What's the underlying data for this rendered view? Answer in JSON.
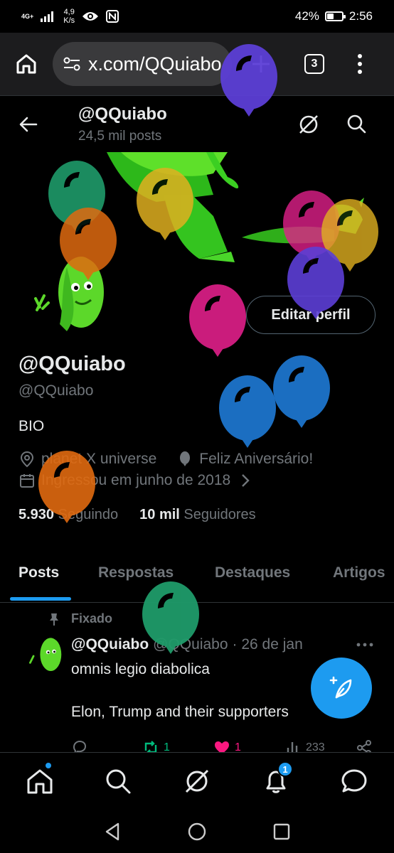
{
  "status_bar": {
    "network": "4G+",
    "speed_value": "4,9",
    "speed_unit": "K/s",
    "battery": "42%",
    "battery_level": 0.42,
    "time": "2:56"
  },
  "browser": {
    "url": "x.com/QQuiabo",
    "tab_count": "3"
  },
  "profile_header": {
    "name": "@QQuiabo",
    "post_count": "24,5 mil posts"
  },
  "profile": {
    "edit_button": "Editar perfil",
    "display_name": "@QQuiabo",
    "handle": "@QQuiabo",
    "bio": "BIO",
    "location": "planet X universe",
    "birthday": "Feliz Aniversário!",
    "joined": "Ingressou em junho de 2018",
    "following_count": "5.930",
    "following_label": "Seguindo",
    "followers_count": "10 mil",
    "followers_label": "Seguidores"
  },
  "tabs": [
    "Posts",
    "Respostas",
    "Destaques",
    "Artigos"
  ],
  "post": {
    "pinned_label": "Fixado",
    "author": "@QQuiabo",
    "handle": "@QQuiabo",
    "date": "· 26 de jan",
    "line1": "omnis legio diabolica",
    "line2": "Elon, Trump and their supporters",
    "retweets": "1",
    "likes": "1",
    "views": "233"
  },
  "bottom_nav": {
    "notifications_badge": "1"
  },
  "colors": {
    "accent": "#1d9bf0",
    "background": "#000000",
    "muted": "#71767b",
    "retweet": "#00ba7c",
    "like": "#f91880"
  }
}
